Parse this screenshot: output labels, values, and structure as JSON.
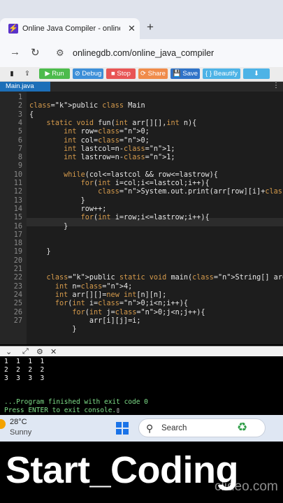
{
  "browser": {
    "tab_title": "Online Java Compiler - online e",
    "tab_close": "✕",
    "new_tab": "+",
    "url": "onlinegdb.com/online_java_compiler"
  },
  "toolbar": {
    "run": "▶ Run",
    "debug": "⊘ Debug",
    "stop": "■ Stop",
    "share": "⟳ Share",
    "save": "💾 Save",
    "beautify": "{ } Beautify",
    "download": "⬇"
  },
  "file_tab": {
    "name": "Main.java",
    "menu": "⋮"
  },
  "editor": {
    "line_numbers": [
      "1",
      "2",
      "3",
      "4",
      "5",
      "6",
      "7",
      "8",
      "9",
      "10",
      "11",
      "12",
      "13",
      "14",
      "15",
      "16",
      "17",
      "18",
      "19",
      "20",
      "21",
      "22",
      "23",
      "24",
      "25",
      "26",
      "27"
    ],
    "lines": [
      "",
      "public class Main",
      "{",
      "    static void fun(int arr[][],int n){",
      "        int row=0;",
      "        int col=0;",
      "        int lastcol=n-1;",
      "        int lastrow=n-1;",
      "",
      "        while(col<=lastcol && row<=lastrow){",
      "            for(int i=col;i<=lastcol;i++){",
      "                System.out.print(arr[row][i]+\" \");",
      "            }",
      "            row++;",
      "            for(int i=row;i<=lastrow;i++){",
      "        }",
      "",
      "",
      "    }",
      "",
      "",
      "    public static void main(String[] args) {",
      "      int n=4;",
      "      int arr[][]=new int[n][n];",
      "      for(int i=0;i<n;i++){",
      "          for(int j=0;j<n;j++){",
      "              arr[i][j]=i;",
      "          }"
    ]
  },
  "console": {
    "output_lines": [
      "1  1  1  1",
      "2  2  2  2",
      "3  3  3  3"
    ],
    "finished": "...Program finished with exit code 0",
    "prompt": "Press ENTER to exit console."
  },
  "taskbar": {
    "temperature": "28°C",
    "condition": "Sunny",
    "search_label": "Search"
  },
  "banner": {
    "text": "Start_Coding",
    "watermark": "clideo.com"
  }
}
